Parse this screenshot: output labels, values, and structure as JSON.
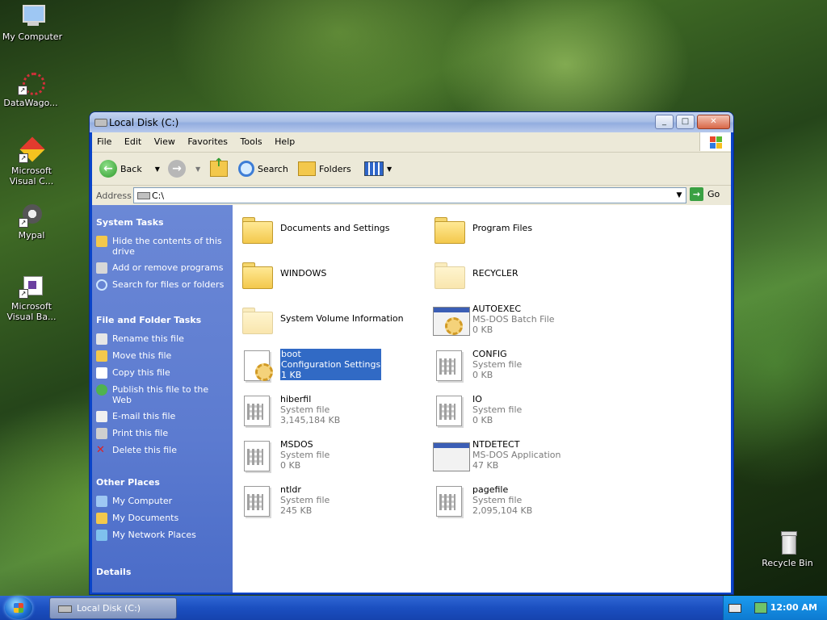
{
  "desktop": {
    "icons": [
      {
        "label": "My Computer"
      },
      {
        "label": "DataWago..."
      },
      {
        "label": "Microsoft Visual C..."
      },
      {
        "label": "Mypal"
      },
      {
        "label": "Microsoft Visual Ba..."
      },
      {
        "label": "Recycle Bin"
      }
    ]
  },
  "window": {
    "title": "Local Disk (C:)",
    "menu": [
      "File",
      "Edit",
      "View",
      "Favorites",
      "Tools",
      "Help"
    ],
    "toolbar": {
      "back": "Back",
      "search": "Search",
      "folders": "Folders"
    },
    "address": {
      "label": "Address",
      "value": "C:\\",
      "go": "Go"
    }
  },
  "taskpane": {
    "system_tasks": {
      "title": "System Tasks",
      "items": [
        "Hide the contents of this drive",
        "Add or remove programs",
        "Search for files or folders"
      ]
    },
    "file_folder_tasks": {
      "title": "File and Folder Tasks",
      "items": [
        "Rename this file",
        "Move this file",
        "Copy this file",
        "Publish this file to the Web",
        "E-mail this file",
        "Print this file",
        "Delete this file"
      ]
    },
    "other_places": {
      "title": "Other Places",
      "items": [
        "My Computer",
        "My Documents",
        "My Network Places"
      ]
    },
    "details": {
      "title": "Details"
    }
  },
  "files": [
    {
      "name": "Documents and Settings",
      "type": "",
      "size": ""
    },
    {
      "name": "Program Files",
      "type": "",
      "size": ""
    },
    {
      "name": "WINDOWS",
      "type": "",
      "size": ""
    },
    {
      "name": "RECYCLER",
      "type": "",
      "size": ""
    },
    {
      "name": "System Volume Information",
      "type": "",
      "size": ""
    },
    {
      "name": "AUTOEXEC",
      "type": "MS-DOS Batch File",
      "size": "0 KB"
    },
    {
      "name": "boot",
      "type": "Configuration Settings",
      "size": "1 KB"
    },
    {
      "name": "CONFIG",
      "type": "System file",
      "size": "0 KB"
    },
    {
      "name": "hiberfil",
      "type": "System file",
      "size": "3,145,184 KB"
    },
    {
      "name": "IO",
      "type": "System file",
      "size": "0 KB"
    },
    {
      "name": "MSDOS",
      "type": "System file",
      "size": "0 KB"
    },
    {
      "name": "NTDETECT",
      "type": "MS-DOS Application",
      "size": "47 KB"
    },
    {
      "name": "ntldr",
      "type": "System file",
      "size": "245 KB"
    },
    {
      "name": "pagefile",
      "type": "System file",
      "size": "2,095,104 KB"
    }
  ],
  "taskbar": {
    "task": "Local Disk (C:)",
    "clock": "12:00 AM"
  }
}
